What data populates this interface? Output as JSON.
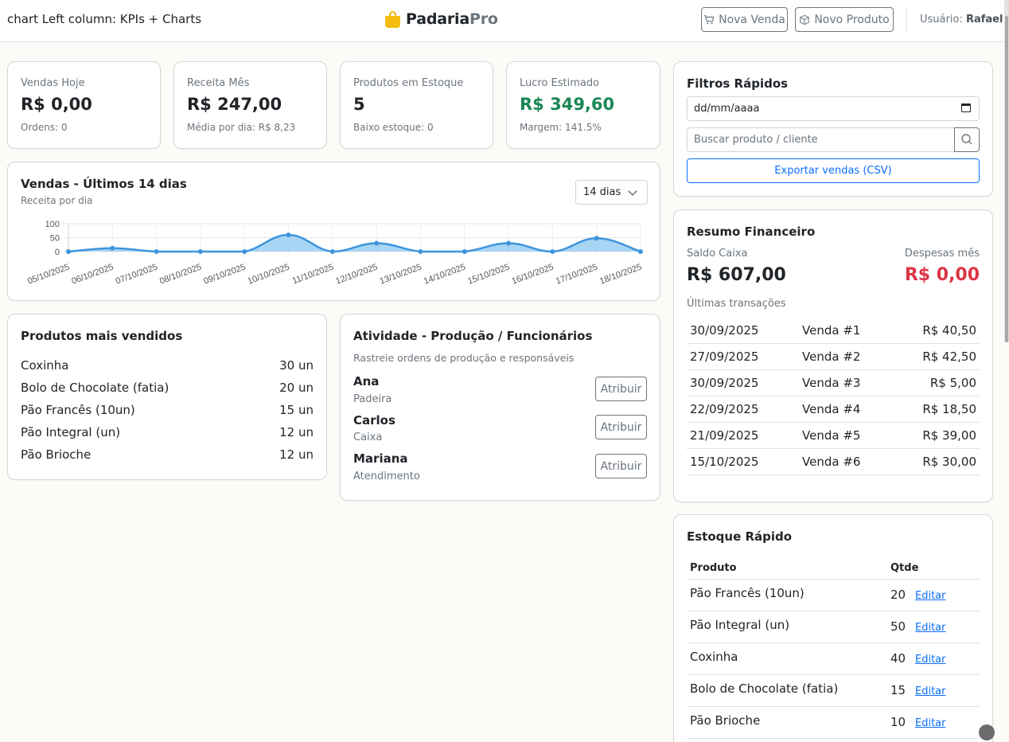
{
  "header": {
    "left_note": "chart Left column: KPIs + Charts",
    "brand_main": "Padaria",
    "brand_accent": "Pro",
    "btn_new_sale": "Nova Venda",
    "btn_new_product": "Novo Produto",
    "user_label": "Usuário:",
    "user_name": "Rafael"
  },
  "kpis": [
    {
      "label": "Vendas Hoje",
      "value": "R$ 0,00",
      "sub": "Ordens: 0"
    },
    {
      "label": "Receita Mês",
      "value": "R$ 247,00",
      "sub": "Média por dia: R$ 8,23"
    },
    {
      "label": "Produtos em Estoque",
      "value": "5",
      "sub": "Baixo estoque: 0"
    },
    {
      "label": "Lucro Estimado",
      "value": "R$ 349,60",
      "sub": "Margem: 141.5%"
    }
  ],
  "sales_chart": {
    "title": "Vendas - Últimos 14 dias",
    "subtitle": "Receita por dia",
    "range_select": "14 dias"
  },
  "chart_data": {
    "type": "area",
    "x": [
      "05/10/2025",
      "06/10/2025",
      "07/10/2025",
      "08/10/2025",
      "09/10/2025",
      "10/10/2025",
      "11/10/2025",
      "12/10/2025",
      "13/10/2025",
      "14/10/2025",
      "15/10/2025",
      "16/10/2025",
      "17/10/2025",
      "18/10/2025"
    ],
    "values": [
      0,
      12,
      0,
      0,
      0,
      60,
      0,
      30,
      0,
      0,
      30,
      0,
      48,
      0
    ],
    "ylim": [
      0,
      100
    ],
    "yticks": [
      0,
      50,
      100
    ],
    "grid": true,
    "color": "#3e95dc",
    "fill": "#9fd0f3"
  },
  "top_products": {
    "title": "Produtos mais vendidos",
    "items": [
      {
        "name": "Coxinha",
        "qty": "30 un"
      },
      {
        "name": "Bolo de Chocolate (fatia)",
        "qty": "20 un"
      },
      {
        "name": "Pão Francês (10un)",
        "qty": "15 un"
      },
      {
        "name": "Pão Integral (un)",
        "qty": "12 un"
      },
      {
        "name": "Pão Brioche",
        "qty": "12 un"
      }
    ]
  },
  "activity": {
    "title": "Atividade - Produção / Funcionários",
    "subtitle": "Rastreie ordens de produção e responsáveis",
    "assign_label": "Atribuir",
    "staff": [
      {
        "name": "Ana",
        "role": "Padeira"
      },
      {
        "name": "Carlos",
        "role": "Caixa"
      },
      {
        "name": "Mariana",
        "role": "Atendimento"
      }
    ]
  },
  "filters": {
    "title": "Filtros Rápidos",
    "date_placeholder": "dd/mm/aaaa",
    "search_placeholder": "Buscar produto / cliente",
    "export_label": "Exportar vendas (CSV)"
  },
  "finance": {
    "title": "Resumo Financeiro",
    "cash_label": "Saldo Caixa",
    "cash_value": "R$ 607,00",
    "expenses_label": "Despesas mês",
    "expenses_value": "R$ 0,00",
    "tx_label": "Últimas transações",
    "transactions": [
      {
        "date": "30/09/2025",
        "ref": "Venda #1",
        "amount": "R$ 40,50"
      },
      {
        "date": "27/09/2025",
        "ref": "Venda #2",
        "amount": "R$ 42,50"
      },
      {
        "date": "30/09/2025",
        "ref": "Venda #3",
        "amount": "R$ 5,00"
      },
      {
        "date": "22/09/2025",
        "ref": "Venda #4",
        "amount": "R$ 18,50"
      },
      {
        "date": "21/09/2025",
        "ref": "Venda #5",
        "amount": "R$ 39,00"
      },
      {
        "date": "15/10/2025",
        "ref": "Venda #6",
        "amount": "R$ 30,00"
      }
    ]
  },
  "stock": {
    "title": "Estoque Rápido",
    "col_product": "Produto",
    "col_qty": "Qtde",
    "edit_label": "Editar",
    "items": [
      {
        "name": "Pão Francês (10un)",
        "qty": "20"
      },
      {
        "name": "Pão Integral (un)",
        "qty": "50"
      },
      {
        "name": "Coxinha",
        "qty": "40"
      },
      {
        "name": "Bolo de Chocolate (fatia)",
        "qty": "15"
      },
      {
        "name": "Pão Brioche",
        "qty": "10"
      }
    ]
  }
}
